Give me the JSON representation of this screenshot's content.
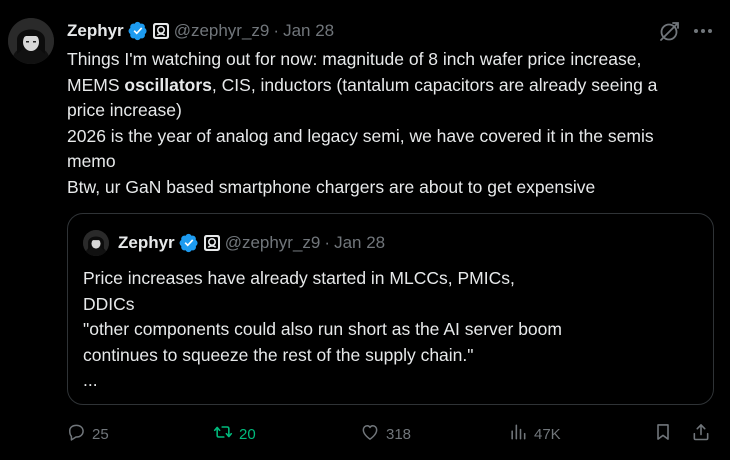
{
  "tweet": {
    "author_name": "Zephyr",
    "handle": "@zephyr_z9",
    "separator": "·",
    "date": "Jan 28",
    "text_lines": [
      {
        "pre": "Things I'm watching out for now: magnitude of 8 inch wafer price increase,",
        "bold": "",
        "post": ""
      },
      {
        "pre": "MEMS ",
        "bold": "oscillators",
        "post": ", CIS, inductors (tantalum capacitors are already seeing a"
      },
      {
        "pre": "price increase)",
        "bold": "",
        "post": ""
      },
      {
        "pre": "2026 is the year of analog and legacy semi, we have covered it in the semis",
        "bold": "",
        "post": ""
      },
      {
        "pre": "memo",
        "bold": "",
        "post": ""
      },
      {
        "pre": "Btw, ur GaN based smartphone chargers are about to get expensive",
        "bold": "",
        "post": ""
      }
    ]
  },
  "quote": {
    "author_name": "Zephyr",
    "handle": "@zephyr_z9",
    "separator": "·",
    "date": "Jan 28",
    "text_lines": [
      "Price increases have already started in MLCCs, PMICs,",
      "DDICs",
      "\"other components could also run short as the AI server boom",
      "continues to squeeze the rest of the supply chain.\"",
      "..."
    ]
  },
  "actions": {
    "replies": "25",
    "reposts": "20",
    "likes": "318",
    "views": "47K"
  },
  "colors": {
    "background": "#000000",
    "text": "#e7e9ea",
    "muted": "#71767b",
    "verified": "#1d9bf0",
    "repost_active": "#00ba7c",
    "border": "#2f3336"
  },
  "icons": [
    "verified-badge-icon",
    "affiliate-badge-icon",
    "grok-icon",
    "more-icon",
    "reply-icon",
    "repost-icon",
    "like-icon",
    "views-icon",
    "bookmark-icon",
    "share-icon"
  ]
}
